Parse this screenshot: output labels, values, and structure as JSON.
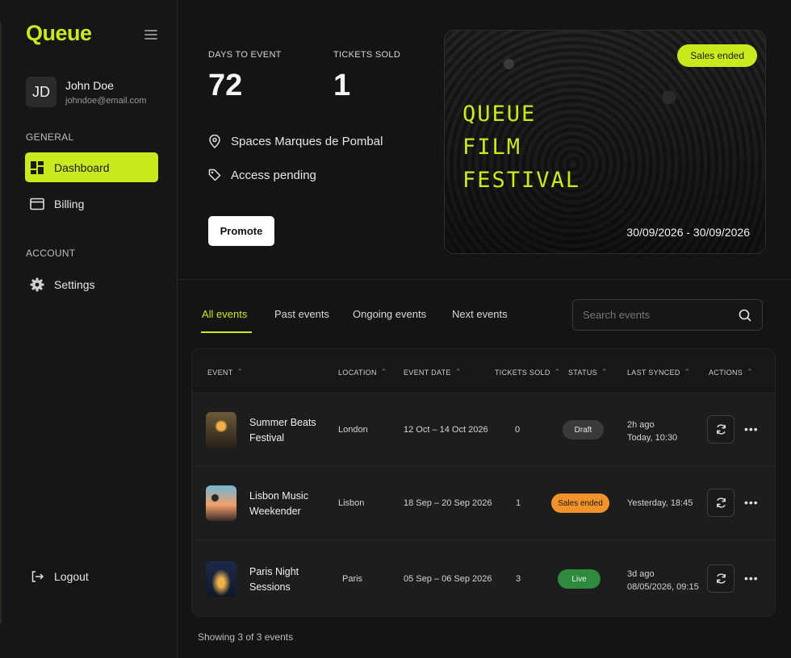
{
  "app": {
    "logo": "Queue",
    "menu_icon": "hamburger-icon"
  },
  "user": {
    "initials": "JD",
    "name": "John Doe",
    "email": "johndoe@email.com"
  },
  "sidebar": {
    "general_label": "GENERAL",
    "account_label": "ACCOUNT",
    "items": [
      {
        "label": "Dashboard",
        "icon": "dashboard-icon",
        "active": true
      },
      {
        "label": "Billing",
        "icon": "card-icon",
        "active": false
      },
      {
        "label": "Settings",
        "icon": "gear-icon",
        "active": false
      }
    ],
    "logout_label": "Logout"
  },
  "overview": {
    "days_label": "DAYS TO EVENT",
    "days_value": "72",
    "tickets_label": "TICKETS SOLD",
    "tickets_value": "1",
    "venue": "Spaces Marques de Pombal",
    "access": "Access pending",
    "promote_label": "Promote"
  },
  "banner": {
    "badge": "Sales ended",
    "title_lines": [
      "QUEUE",
      "FILM",
      "FESTIVAL"
    ],
    "dates": "30/09/2026 - 30/09/2026"
  },
  "tabs": [
    "All events",
    "Past events",
    "Ongoing events",
    "Next events"
  ],
  "search": {
    "placeholder": "Search events"
  },
  "table": {
    "headers": [
      "EVENT",
      "LOCATION",
      "EVENT DATE",
      "TICKETS SOLD",
      "STATUS",
      "LAST SYNCED",
      "ACTIONS"
    ],
    "rows": [
      {
        "name": "Summer Beats Festival",
        "location": "London",
        "date": "12 Oct – 14 Oct 2026",
        "tickets": "0",
        "status": "Draft",
        "synced_1": "2h ago",
        "synced_2": "Today, 10:30"
      },
      {
        "name": "Lisbon Music Weekender",
        "location": "Lisbon",
        "date": "18 Sep – 20 Sep 2026",
        "tickets": "1",
        "status": "Sales ended",
        "synced_1": "Yesterday, 18:45",
        "synced_2": ""
      },
      {
        "name": "Paris Night Sessions",
        "location": "Paris",
        "date": "05 Sep – 06 Sep 2026",
        "tickets": "3",
        "status": "Live",
        "synced_1": "3d ago",
        "synced_2": "08/05/2026, 09:15"
      }
    ]
  },
  "footer": {
    "showing": "Showing 3 of 3 events"
  },
  "colors": {
    "accent": "#c9ea1f",
    "draft": "#3a3a3a",
    "sales_ended": "#f2922b",
    "live": "#2f8a3e"
  }
}
